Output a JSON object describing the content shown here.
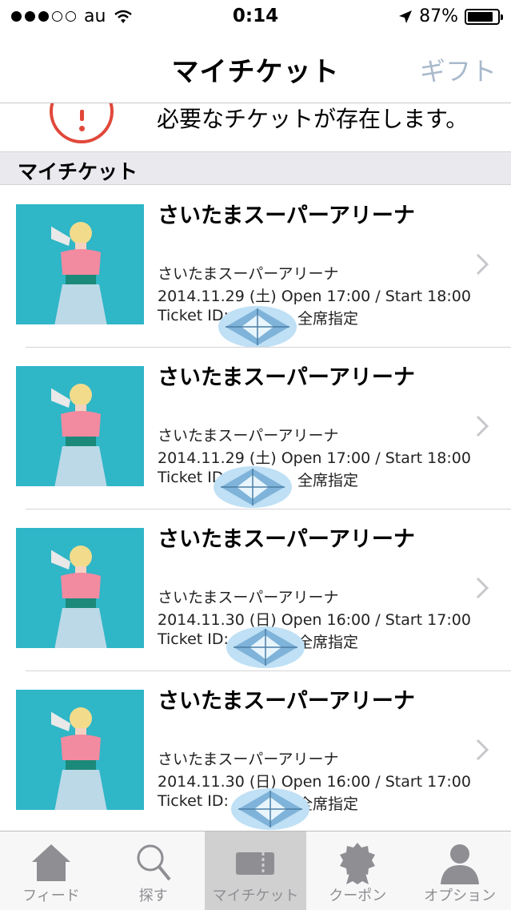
{
  "status_bar": {
    "carrier": "au",
    "time": "0:14",
    "battery": "87%",
    "battery_level": 0.87
  },
  "nav": {
    "title": "マイチケット",
    "gift_label": "ギフト"
  },
  "notice": {
    "message": "必要なチケットが存在します。"
  },
  "section": {
    "title": "マイチケット"
  },
  "tickets": [
    {
      "title": "さいたまスーパーアリーナ",
      "venue": "さいたまスーパーアリーナ",
      "date": "2014.11.29 (土) Open 17:00 / Start 18:00",
      "ticket_id": "Ticket ID:",
      "seat": "全席指定"
    },
    {
      "title": "さいたまスーパーアリーナ",
      "venue": "さいたまスーパーアリーナ",
      "date": "2014.11.29 (土) Open 17:00 / Start 18:00",
      "ticket_id": "Ticket ID:",
      "seat": "全席指定"
    },
    {
      "title": "さいたまスーパーアリーナ",
      "venue": "さいたまスーパーアリーナ",
      "date": "2014.11.30 (日) Open 16:00 / Start 17:00",
      "ticket_id": "Ticket ID:",
      "seat": "全席指定"
    },
    {
      "title": "さいたまスーパーアリーナ",
      "venue": "さいたまスーパーアリーナ",
      "date": "2014.11.30 (日) Open 16:00 / Start 17:00",
      "ticket_id": "Ticket ID:",
      "seat": "全席指定"
    }
  ],
  "tabs": [
    {
      "label": "フィード",
      "icon": "home-icon"
    },
    {
      "label": "探す",
      "icon": "search-icon"
    },
    {
      "label": "マイチケット",
      "icon": "ticket-icon",
      "active": true
    },
    {
      "label": "クーポン",
      "icon": "badge-icon"
    },
    {
      "label": "オプション",
      "icon": "person-icon"
    }
  ]
}
